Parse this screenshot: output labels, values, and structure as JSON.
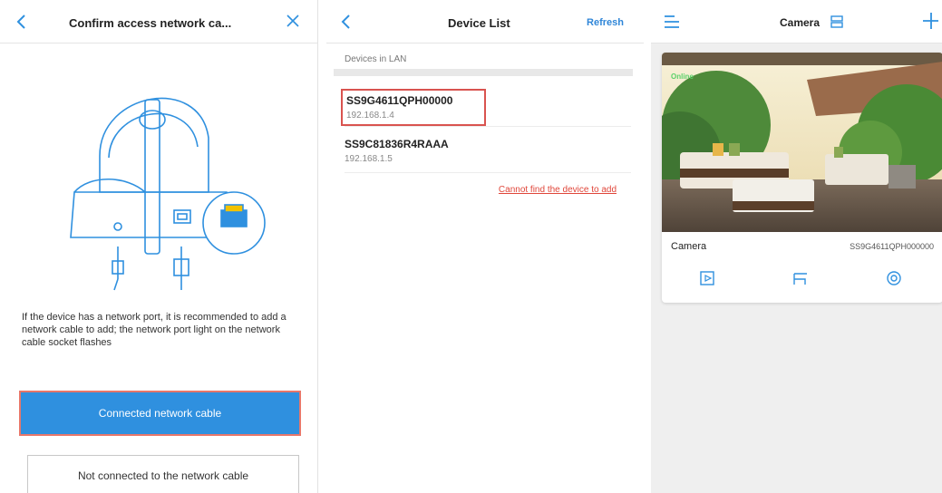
{
  "panel1": {
    "title": "Confirm access network ca...",
    "description": "If the device has a network port, it is recommended to add a network cable to add; the network port light on the network cable socket flashes",
    "primary_button": "Connected network cable",
    "secondary_button": "Not connected to the network cable"
  },
  "panel2": {
    "title": "Device List",
    "refresh_label": "Refresh",
    "section_label": "Devices in LAN",
    "devices": [
      {
        "sn": "SS9G4611QPH00000",
        "ip": "192.168.1.4"
      },
      {
        "sn": "SS9C81836R4RAAA",
        "ip": "192.168.1.5"
      }
    ],
    "not_found_link": "Cannot find the device to add"
  },
  "panel3": {
    "title": "Camera",
    "card": {
      "status": "Online",
      "name": "Camera",
      "serial": "SS9G4611QPH000000"
    }
  },
  "colors": {
    "accent_blue": "#2f90df",
    "highlight_red": "#d9534f",
    "online_green": "#5bd16a"
  }
}
